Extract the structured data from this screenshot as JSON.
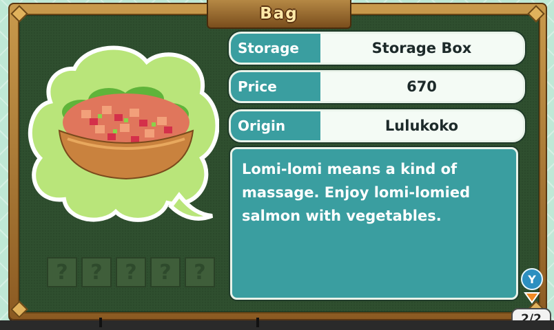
{
  "title": "Bag",
  "item": {
    "name_icon": "lomi-lomi-salmon-bowl-icon",
    "fields": [
      {
        "label": "Storage",
        "value": "Storage Box"
      },
      {
        "label": "Price",
        "value": "670"
      },
      {
        "label": "Origin",
        "value": "Lulukoko"
      }
    ],
    "description": "Lomi-lomi means a kind of massage. Enjoy lomi-lomied salmon with vegetables."
  },
  "slots": [
    "?",
    "?",
    "?",
    "?",
    "?"
  ],
  "controls": {
    "y_button": "Y",
    "page": "2/2"
  },
  "colors": {
    "board": "#2f4f2f",
    "accent_teal": "#3a9ea0",
    "frame_wood": "#b58845",
    "cloud": "#b9e57a"
  }
}
